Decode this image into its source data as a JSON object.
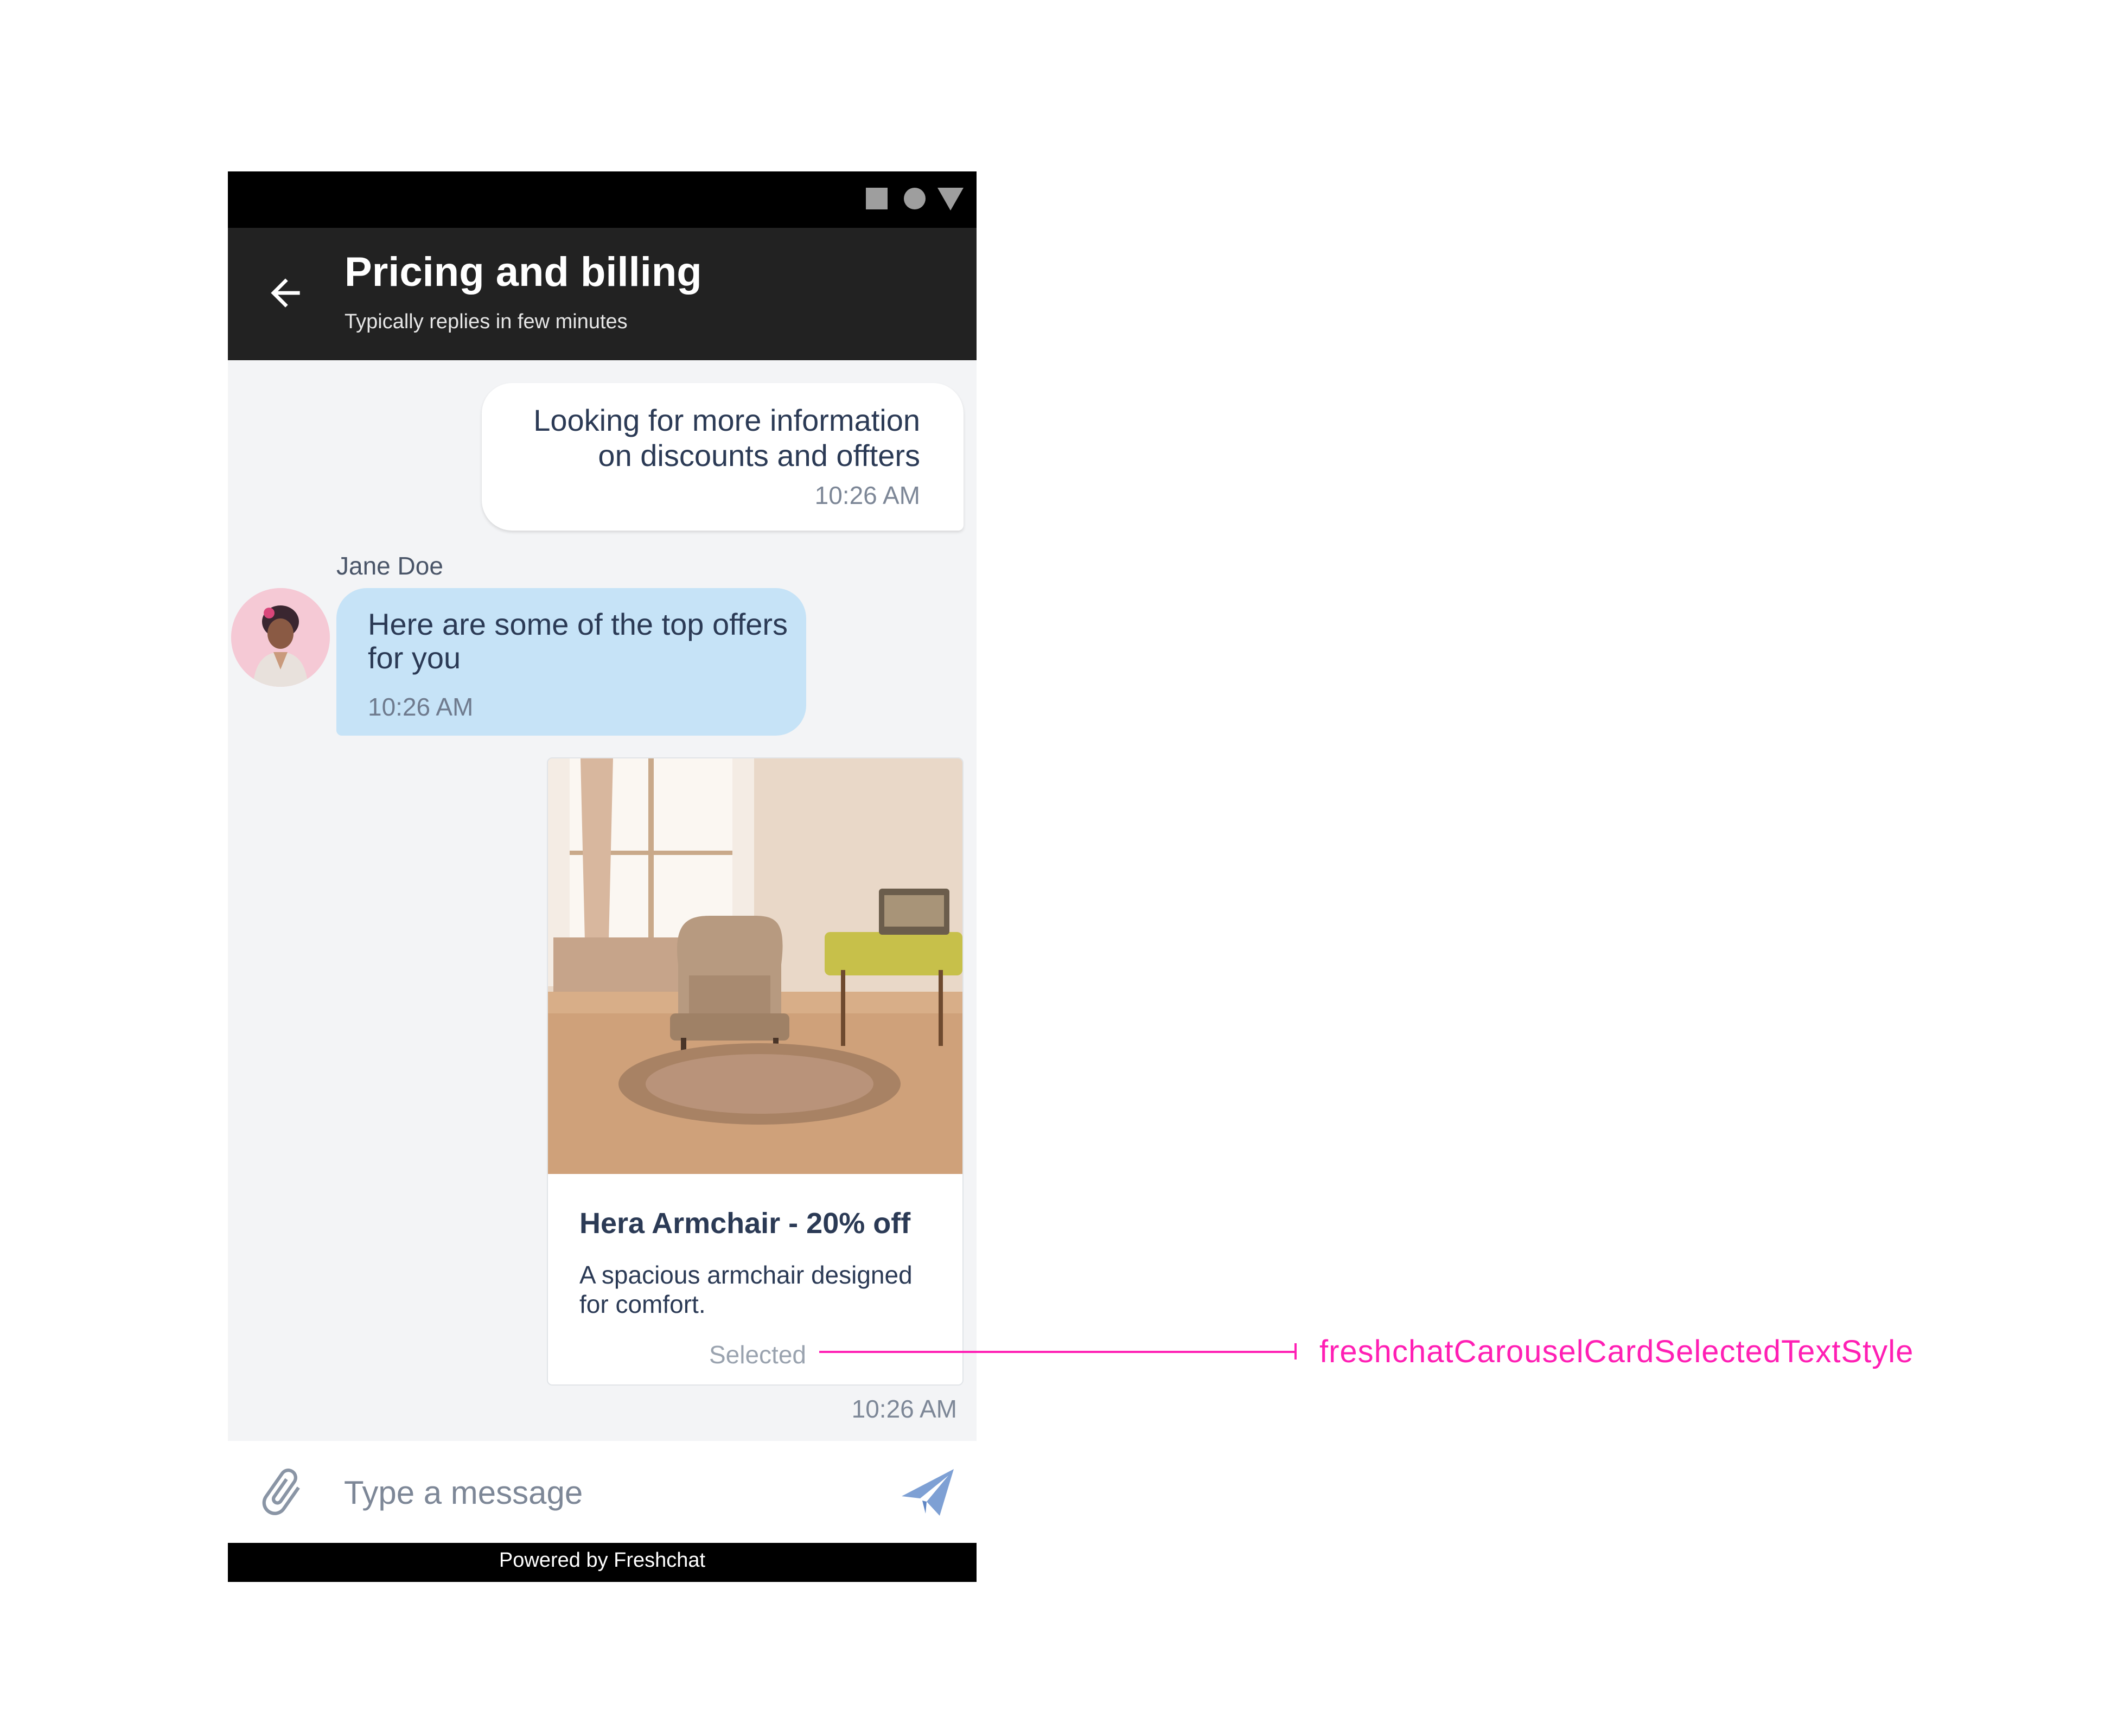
{
  "status_bar": {
    "icons": [
      "square-icon",
      "circle-icon",
      "triangle-icon"
    ],
    "background": "#000000"
  },
  "header": {
    "title": "Pricing and billing",
    "subtitle": "Typically replies in few minutes",
    "back_icon": "arrow-left-icon",
    "background": "#222222"
  },
  "messages": {
    "user": {
      "text": "Looking for more information on discounts and offters",
      "time": "10:26 AM"
    },
    "agent": {
      "name": "Jane Doe",
      "text": "Here are some of the top offers for you",
      "time": "10:26 AM",
      "bubble_color": "#c6e3f7"
    }
  },
  "carousel_card": {
    "title": "Hera Armchair  -  20% off",
    "description": "A spacious armchair designed for comfort.",
    "selected_label": "Selected",
    "time": "10:26 AM"
  },
  "composer": {
    "placeholder": "Type a message",
    "attach_icon": "paperclip-icon",
    "send_icon": "send-icon"
  },
  "footer": {
    "powered_by": "Powered by Freshchat"
  },
  "annotation": {
    "label": "freshchatCarouselCardSelectedTextStyle",
    "color": "#ff1fb4"
  }
}
